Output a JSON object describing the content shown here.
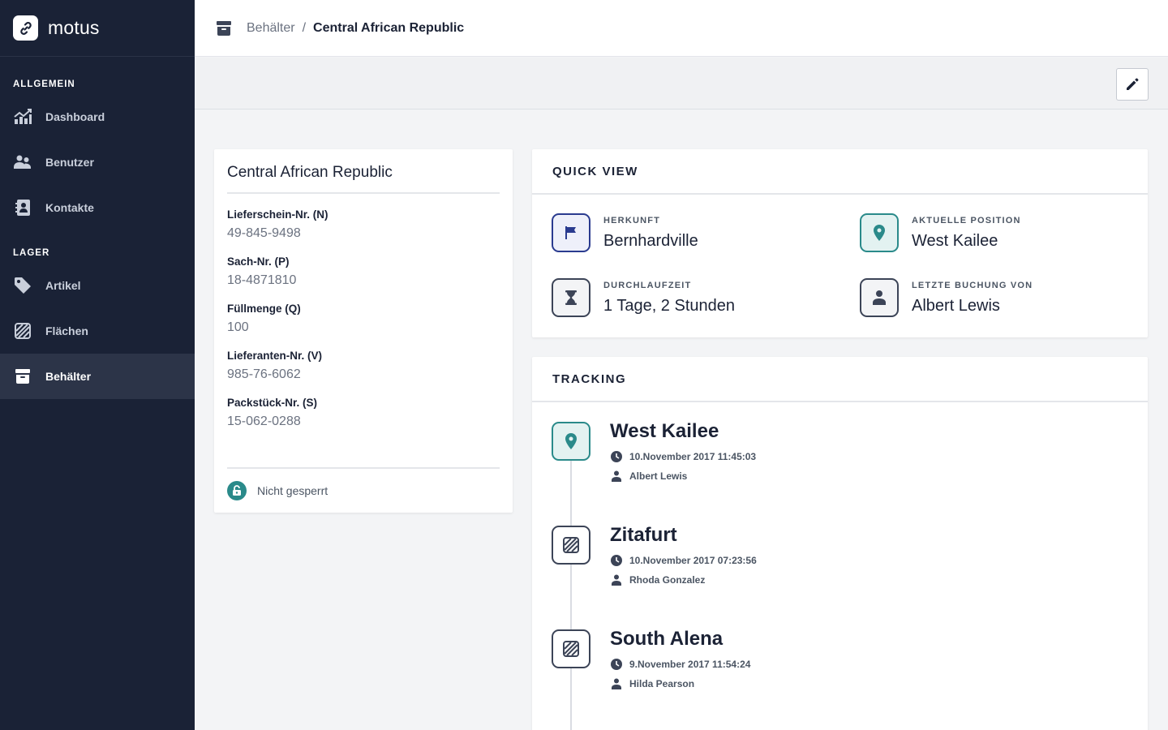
{
  "brand": {
    "name": "motus"
  },
  "sidebar": {
    "sections": [
      {
        "title": "ALLGEMEIN"
      },
      {
        "title": "LAGER"
      }
    ],
    "items": [
      {
        "label": "Dashboard",
        "icon": "chart-icon"
      },
      {
        "label": "Benutzer",
        "icon": "users-icon"
      },
      {
        "label": "Kontakte",
        "icon": "address-book-icon"
      },
      {
        "label": "Artikel",
        "icon": "tag-icon"
      },
      {
        "label": "Flächen",
        "icon": "hatched-area-icon"
      },
      {
        "label": "Behälter",
        "icon": "container-icon",
        "active": true
      }
    ]
  },
  "breadcrumb": {
    "parent": "Behälter",
    "separator": "/",
    "current": "Central African Republic"
  },
  "details": {
    "title": "Central African Republic",
    "fields": [
      {
        "label": "Lieferschein-Nr. (N)",
        "value": "49-845-9498"
      },
      {
        "label": "Sach-Nr. (P)",
        "value": "18-4871810"
      },
      {
        "label": "Füllmenge (Q)",
        "value": "100"
      },
      {
        "label": "Lieferanten-Nr. (V)",
        "value": "985-76-6062"
      },
      {
        "label": "Packstück-Nr. (S)",
        "value": "15-062-0288"
      }
    ],
    "lock_status": "Nicht gesperrt"
  },
  "quick_view": {
    "title": "QUICK VIEW",
    "items": [
      {
        "label": "HERKUNFT",
        "value": "Bernhardville",
        "icon": "flag-icon"
      },
      {
        "label": "AKTUELLE POSITION",
        "value": "West Kailee",
        "icon": "location-pin-icon"
      },
      {
        "label": "DURCHLAUFZEIT",
        "value": "1 Tage, 2 Stunden",
        "icon": "hourglass-icon"
      },
      {
        "label": "LETZTE BUCHUNG VON",
        "value": "Albert Lewis",
        "icon": "user-icon"
      }
    ]
  },
  "tracking": {
    "title": "TRACKING",
    "entries": [
      {
        "place": "West Kailee",
        "time": "10.November 2017 11:45:03",
        "user": "Albert Lewis",
        "icon": "location-pin-icon"
      },
      {
        "place": "Zitafurt",
        "time": "10.November 2017 07:23:56",
        "user": "Rhoda Gonzalez",
        "icon": "hatched-area-icon"
      },
      {
        "place": "South Alena",
        "time": "9.November 2017 11:54:24",
        "user": "Hilda Pearson",
        "icon": "hatched-area-icon"
      }
    ]
  },
  "colors": {
    "sidebar_bg": "#1a2236",
    "accent_teal": "#2a8a8a",
    "accent_blue": "#2a3b8f"
  }
}
